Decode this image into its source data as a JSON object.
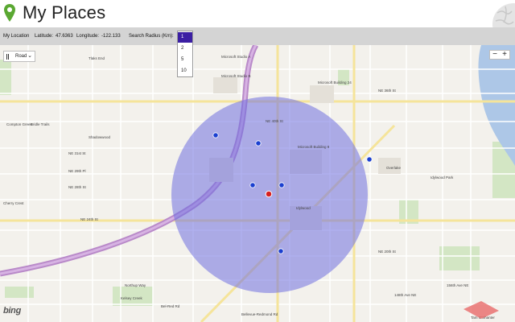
{
  "app": {
    "title": "My Places"
  },
  "location_bar": {
    "my_location_label": "My Location",
    "latitude_label": "Latitude:",
    "latitude_value": "47.6363",
    "longitude_label": "Longitude:",
    "longitude_value": "-122.133",
    "radius_label": "Search Radius (Km):"
  },
  "radius_dropdown": {
    "options": [
      "1",
      "2",
      "5",
      "10"
    ],
    "selected": "1"
  },
  "map": {
    "style_label": "Road",
    "zoom_out": "−",
    "zoom_in": "+",
    "provider": "bing",
    "radius_circle_color": "#6f6fe0",
    "center_pin_color": "#d62020",
    "place_marker_color": "#1a3fd0",
    "labels": [
      "Tlaks End",
      "Compton Green",
      "Bridle Trails",
      "Shadowwood",
      "Microsoft Studio A",
      "Microsoft Studio B",
      "Microsoft Building 24",
      "Microsoft Building 9",
      "NE 40th St",
      "NE 36th St",
      "NE 31st St",
      "NE 29th Pl",
      "NE 28th St",
      "NE 24th St",
      "NE 20th St",
      "Overlake",
      "Idylwood Park",
      "Idylwood",
      "Kelsey Creek",
      "Cherry Crest",
      "Northup Way",
      "Bellevue-Redmond Rd",
      "148th Ave NE",
      "156th Ave NE",
      "Bel-Red Rd",
      "Tam O'Shanter"
    ]
  }
}
